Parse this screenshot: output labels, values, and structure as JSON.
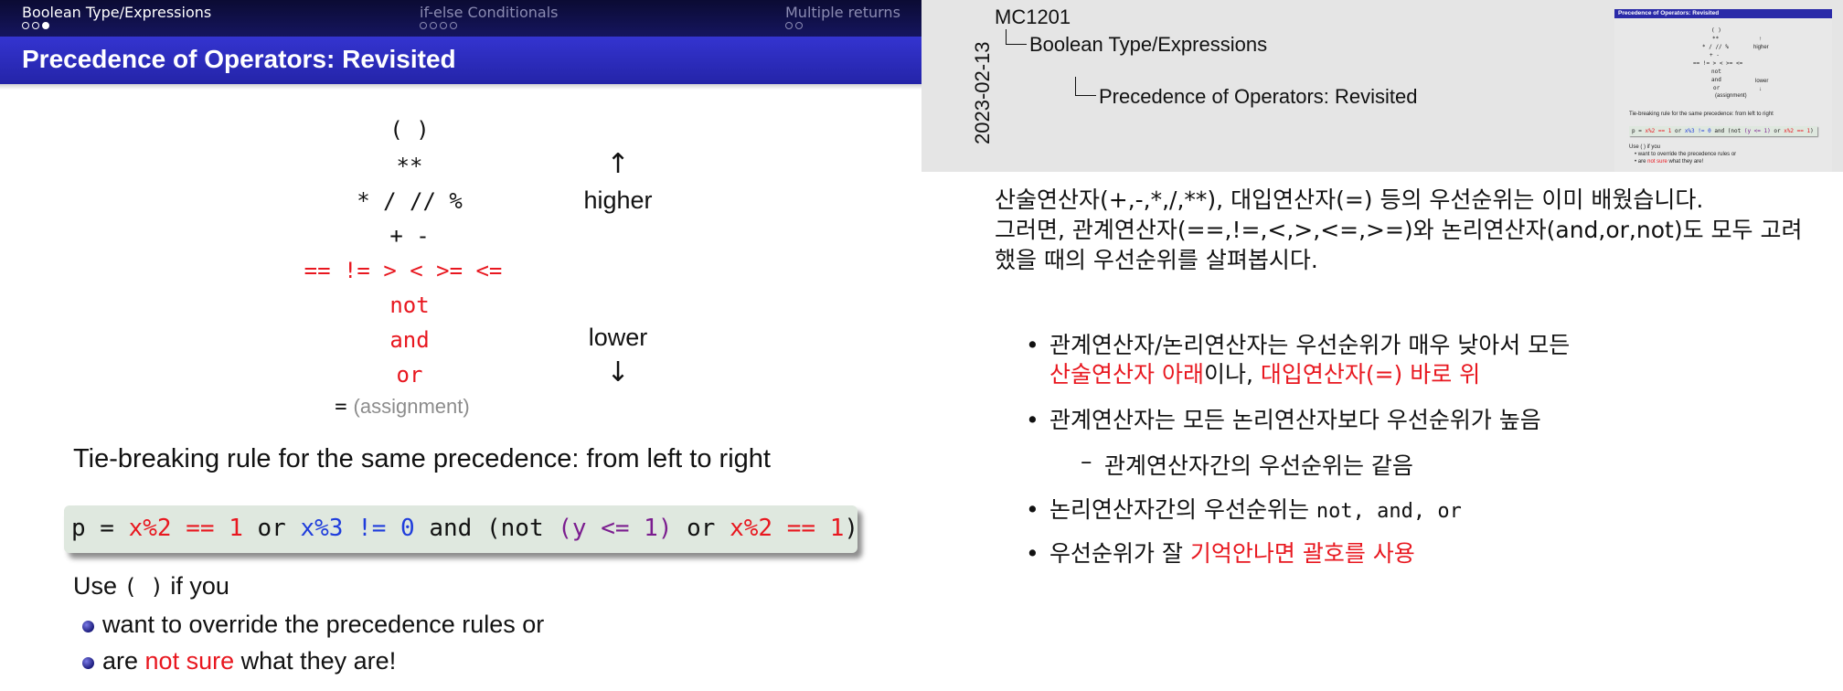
{
  "slide": {
    "nav": {
      "sections": [
        {
          "title": "Boolean Type/Expressions"
        },
        {
          "title": "if-else Conditionals"
        },
        {
          "title": "Multiple returns"
        }
      ]
    },
    "title": "Precedence of Operators: Revisited",
    "precedence": {
      "paren": "( )",
      "power": "**",
      "mult": "* / // %",
      "add": "+ -",
      "compare": "== != > < >= <=",
      "not": "not",
      "and": "and",
      "or": "or",
      "assign_eq": "=",
      "assign_label": "(assignment)",
      "up_arrow": "↑",
      "higher": "higher",
      "lower": "lower",
      "down_arrow": "↓"
    },
    "tie_break": "Tie-breaking rule for the same precedence: from left to right",
    "code": {
      "p1": "p = ",
      "c1": "x%2 == 1",
      "or1": " or ",
      "c2": "x%3 != 0",
      "and1": " and (not ",
      "c3": "(y <= 1)",
      "or2": " or ",
      "c4": "x%2 == 1",
      "close": ")"
    },
    "use_parens": {
      "pre": "Use ",
      "paren": "( )",
      "post": " if you"
    },
    "bullets": {
      "b1": "want to override the precedence rules or",
      "b2_pre": "are ",
      "b2_red": "not sure",
      "b2_post": " what they are!"
    }
  },
  "notes": {
    "date": "2023-02-13",
    "course": "MC1201",
    "crumb_section": "Boolean Type/Expressions",
    "crumb_slide": "Precedence of Operators: Revisited",
    "intro_line1": "산술연산자(+,-,*,/,**), 대입연산자(=) 등의 우선순위는 이미 배웠습니다.",
    "intro_line2": "그러면, 관계연산자(==,!=,<,>,<=,>=)와 논리연산자(and,or,not)도 모두 고려했을 때의 우선순위를 살펴봅시다.",
    "bullet1_line1": "관계연산자/논리연산자는 우선순위가 매우 낮아서 모든",
    "bullet1_red1": "산술연산자 아래",
    "bullet1_mid": "이나, ",
    "bullet1_red2": "대입연산자(=) 바로 위",
    "bullet2": "관계연산자는 모든 논리연산자보다 우선순위가 높음",
    "bullet2_sub": "관계연산자간의 우선순위는 같음",
    "bullet3_pre": "논리연산자간의 우선순위는 ",
    "bullet3_code": "not, and, or",
    "bullet4_pre": "우선순위가 잘 ",
    "bullet4_red": "기억안나면 괄호를 사용"
  },
  "colors": {
    "nav_bg": "#15155e",
    "title_bg": "#2a2ab8",
    "accent_red": "#e8171f",
    "accent_blue": "#1f3ddc",
    "accent_purple": "#7b1d8f",
    "code_bg": "#dfe8df"
  }
}
